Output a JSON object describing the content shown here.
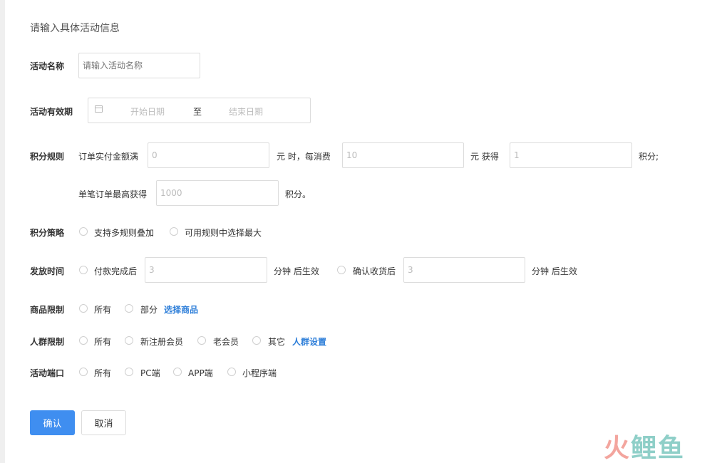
{
  "heading": "请输入具体活动信息",
  "activity_name": {
    "label": "活动名称",
    "placeholder": "请输入活动名称"
  },
  "validity": {
    "label": "活动有效期",
    "start": "开始日期",
    "separator": "至",
    "end": "结束日期"
  },
  "points_rule": {
    "label": "积分规则",
    "prefix": "订单实付金额满",
    "amount_value": "0",
    "yuan_when": "元 时，每消费",
    "spend_value": "10",
    "yuan_get": "元 获得",
    "points_value": "1",
    "points_suffix": "积分;",
    "max_prefix": "单笔订单最高获得",
    "max_value": "1000",
    "max_suffix": "积分。"
  },
  "points_strategy": {
    "label": "积分策略",
    "options": [
      "支持多规则叠加",
      "可用规则中选择最大"
    ]
  },
  "issue_time": {
    "label": "发放时间",
    "option1": "付款完成后",
    "minutes1": "3",
    "suffix1": "分钟 后生效",
    "option2": "确认收货后",
    "minutes2": "3",
    "suffix2": "分钟 后生效"
  },
  "product_limit": {
    "label": "商品限制",
    "options": [
      "所有",
      "部分"
    ],
    "link": "选择商品"
  },
  "crowd_limit": {
    "label": "人群限制",
    "options": [
      "所有",
      "新注册会员",
      "老会员",
      "其它"
    ],
    "link": "人群设置"
  },
  "platform": {
    "label": "活动端口",
    "options": [
      "所有",
      "PC端",
      "APP端",
      "小程序端"
    ]
  },
  "actions": {
    "confirm": "确认",
    "cancel": "取消"
  },
  "watermark": {
    "part1": "火",
    "part2": "鲤鱼"
  },
  "colors": {
    "primary": "#3f8ef0",
    "link": "#2f7fd9",
    "border": "#dcdcdc"
  }
}
